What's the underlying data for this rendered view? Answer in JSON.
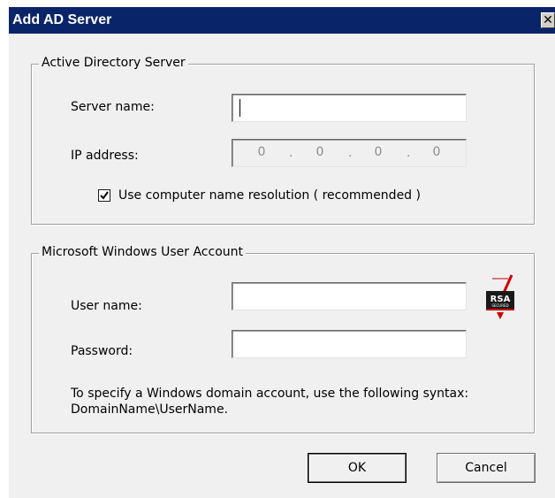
{
  "window": {
    "title": "Add AD Server",
    "close_symbol": "✕"
  },
  "ad_server_group": {
    "legend": "Active Directory Server",
    "server_name_label": "Server name:",
    "server_name_value": "",
    "ip_label": "IP address:",
    "ip_octets": [
      "0",
      "0",
      "0",
      "0"
    ],
    "ip_separator": ".",
    "use_name_resolution_label": "Use computer name resolution ( recommended )",
    "use_name_resolution_checked": true
  },
  "user_account_group": {
    "legend": "Microsoft Windows User Account",
    "user_name_label": "User name:",
    "user_name_value": "",
    "password_label": "Password:",
    "password_value": "",
    "hint_line1": "To specify a Windows domain account, use the following syntax:",
    "hint_line2": "DomainName\\UserName.",
    "rsa_badge_text": "RSA",
    "rsa_badge_subtext": "SECURED"
  },
  "buttons": {
    "ok": "OK",
    "cancel": "Cancel"
  },
  "colors": {
    "titlebar": "#0a246a",
    "dialog_bg": "#f0f0f0",
    "rsa_red": "#cc0000"
  },
  "icons": {
    "close": "close-icon",
    "check": "checkmark-icon",
    "rsa": "rsa-secured-logo"
  }
}
